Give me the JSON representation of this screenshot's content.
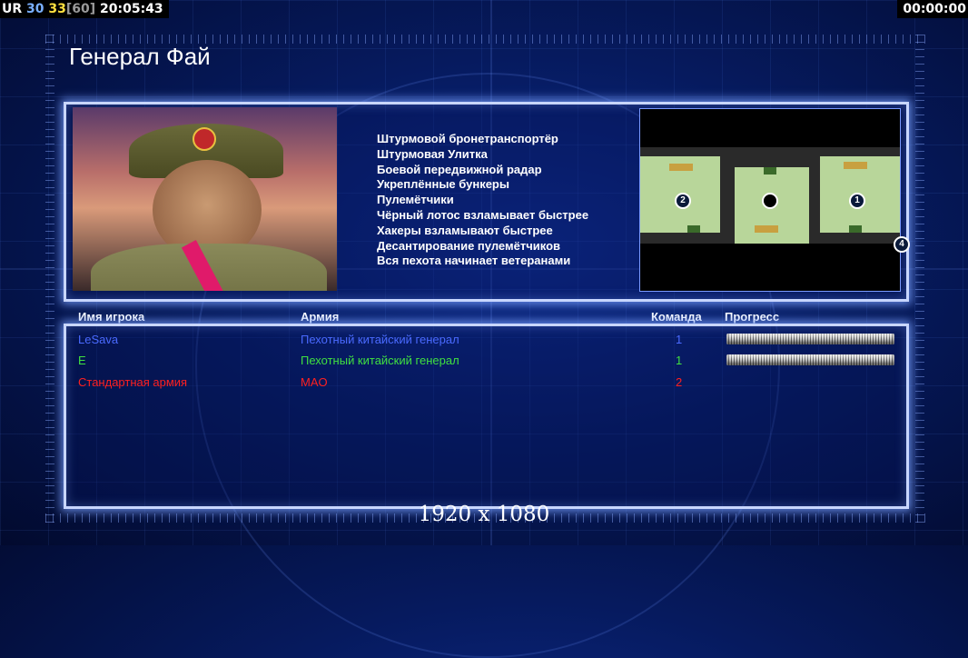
{
  "hud": {
    "left": {
      "tag": "UR",
      "fps": "30",
      "fps2": "33",
      "fps_cap": "[60]",
      "clock": "20:05:43"
    },
    "right_timer": "00:00:00",
    "colors": {
      "tag": "#ffffff",
      "fps": "#7ab0ff",
      "fps2": "#ffe040",
      "fps_cap": "#9a9a9a",
      "clock": "#ffffff"
    }
  },
  "title": "Генерал Фай",
  "bonuses": [
    "Штурмовой бронетранспортёр",
    "Штурмовая Улитка",
    "Боевой передвижной радар",
    "Укреплённые бункеры",
    "Пулемётчики",
    "Чёрный лотос взламывает быстрее",
    "Хакеры взламывают быстрее",
    "Десантирование пулемётчиков",
    "Вся пехота начинает ветеранами"
  ],
  "minimap": {
    "slots": [
      {
        "label": "2"
      },
      {
        "label": ""
      },
      {
        "label": "1"
      },
      {
        "label": "4"
      }
    ]
  },
  "table": {
    "headers": {
      "name": "Имя игрока",
      "army": "Армия",
      "team": "Команда",
      "progress": "Прогресс"
    },
    "rows": [
      {
        "name": "LeSava",
        "army": "Пехотный китайский генерал",
        "team": "1",
        "color": "#4a6aff",
        "progress": 1.0
      },
      {
        "name": "E",
        "army": "Пехотный китайский генерал",
        "team": "1",
        "color": "#40e040",
        "progress": 1.0
      },
      {
        "name": "Стандартная армия",
        "army": "MAO",
        "team": "2",
        "color": "#ff2020",
        "progress": null
      }
    ]
  },
  "resolution_label": "1920 x 1080"
}
